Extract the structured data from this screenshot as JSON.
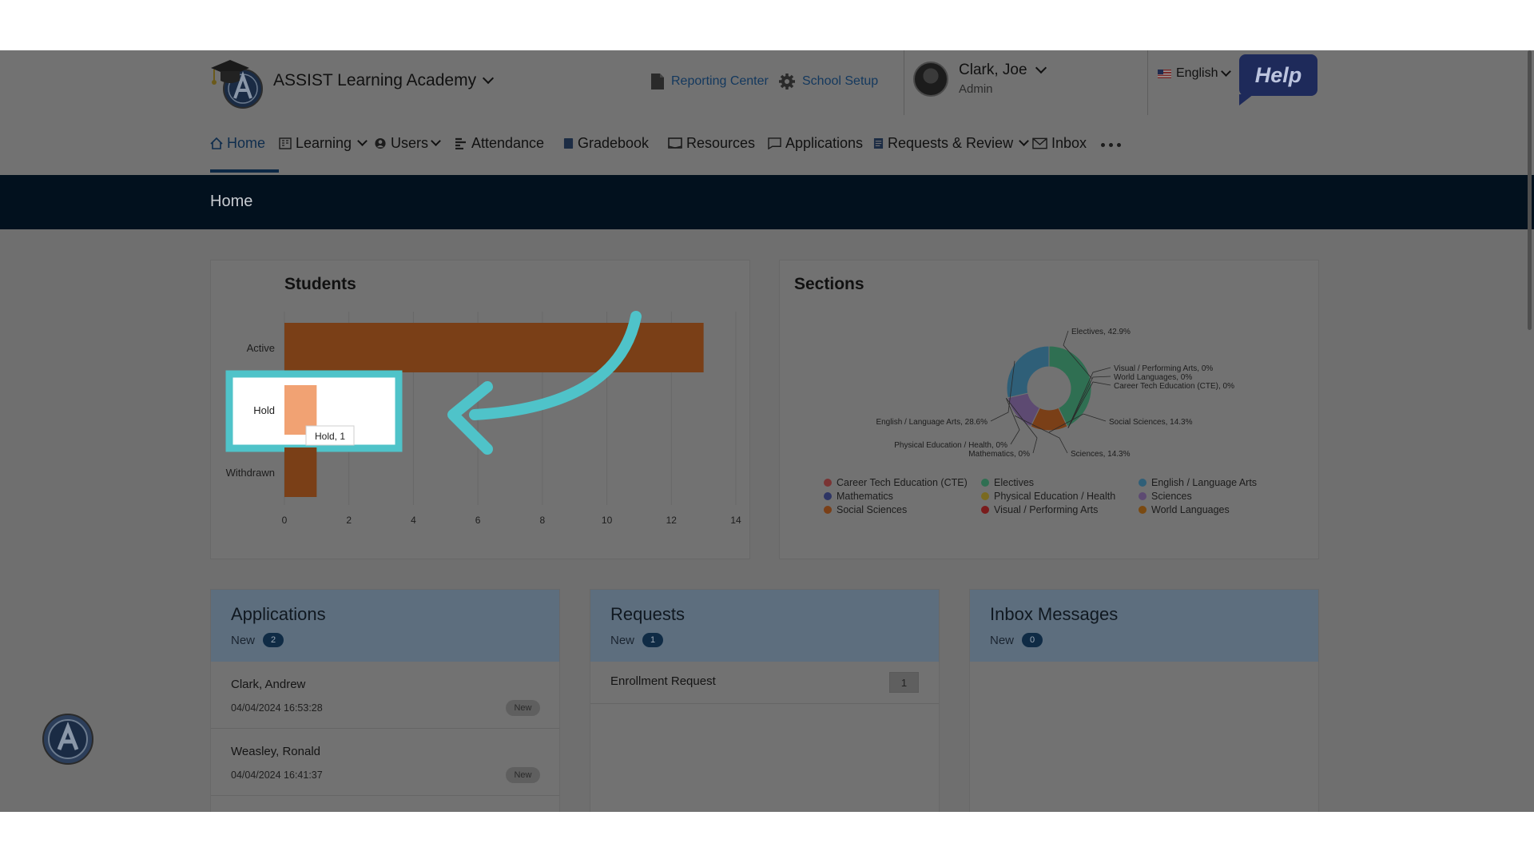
{
  "header": {
    "school_name": "ASSIST Learning Academy",
    "reporting_center": "Reporting Center",
    "school_setup": "School Setup",
    "user_name": "Clark, Joe",
    "user_role": "Admin",
    "language": "English",
    "help_label": "Help"
  },
  "nav": {
    "items": [
      {
        "label": "Home",
        "icon": "home-icon",
        "active": true
      },
      {
        "label": "Learning",
        "icon": "learning-icon",
        "dropdown": true
      },
      {
        "label": "Users",
        "icon": "users-icon",
        "dropdown": true
      },
      {
        "label": "Attendance",
        "icon": "attendance-icon"
      },
      {
        "label": "Gradebook",
        "icon": "gradebook-icon"
      },
      {
        "label": "Resources",
        "icon": "resources-icon"
      },
      {
        "label": "Applications",
        "icon": "applications-icon"
      },
      {
        "label": "Requests & Review",
        "icon": "requests-icon",
        "dropdown": true
      },
      {
        "label": "Inbox",
        "icon": "inbox-icon"
      }
    ]
  },
  "page_title": "Home",
  "students": {
    "title": "Students",
    "tooltip": "Hold, 1"
  },
  "sections": {
    "title": "Sections"
  },
  "chart_data": [
    {
      "type": "bar",
      "orientation": "horizontal",
      "title": "Students",
      "categories": [
        "Active",
        "Hold",
        "Withdrawn"
      ],
      "values": [
        13,
        1,
        1
      ],
      "xlim": [
        0,
        14
      ],
      "xticks": [
        0,
        2,
        4,
        6,
        8,
        10,
        12,
        14
      ],
      "grid": true,
      "highlight": "Hold",
      "colors": {
        "bar": "#7a3f17",
        "highlight_bar": "#f1a273"
      }
    },
    {
      "type": "pie",
      "donut": true,
      "title": "Sections",
      "slices": [
        {
          "name": "Electives",
          "value": 42.9,
          "label": "Electives, 42.9%",
          "color": "#2f6f52"
        },
        {
          "name": "Visual / Performing Arts",
          "value": 0,
          "label": "Visual / Performing Arts, 0%",
          "color": "#7a1c1c"
        },
        {
          "name": "World Languages",
          "value": 0,
          "label": "World Languages, 0%",
          "color": "#7a4a12"
        },
        {
          "name": "Career Tech Education (CTE)",
          "value": 0,
          "label": "Career Tech Education (CTE), 0%",
          "color": "#7a3434"
        },
        {
          "name": "Social Sciences",
          "value": 14.3,
          "label": "Social Sciences, 14.3%",
          "color": "#7a3f17"
        },
        {
          "name": "Sciences",
          "value": 14.3,
          "label": "Sciences, 14.3%",
          "color": "#5d4a72"
        },
        {
          "name": "Mathematics",
          "value": 0,
          "label": "Mathematics, 0%",
          "color": "#2e3564"
        },
        {
          "name": "Physical Education / Health",
          "value": 0,
          "label": "Physical Education / Health, 0%",
          "color": "#7a6a20"
        },
        {
          "name": "English / Language Arts",
          "value": 28.6,
          "label": "English / Language Arts, 28.6%",
          "color": "#2f5f78"
        }
      ],
      "legend": [
        {
          "name": "Career Tech Education (CTE)",
          "color": "#7a3434"
        },
        {
          "name": "Electives",
          "color": "#2f6f52"
        },
        {
          "name": "English / Language Arts",
          "color": "#2f5f78"
        },
        {
          "name": "Mathematics",
          "color": "#2e3564"
        },
        {
          "name": "Physical Education / Health",
          "color": "#7a6a20"
        },
        {
          "name": "Sciences",
          "color": "#5d4a72"
        },
        {
          "name": "Social Sciences",
          "color": "#7a3f17"
        },
        {
          "name": "Visual / Performing Arts",
          "color": "#7a1c1c"
        },
        {
          "name": "World Languages",
          "color": "#7a4a12"
        }
      ],
      "legend_placement": "bottom"
    }
  ],
  "applications": {
    "title": "Applications",
    "new_label": "New",
    "new_count": "2",
    "items": [
      {
        "name": "Clark, Andrew",
        "date": "04/04/2024 16:53:28",
        "badge": "New"
      },
      {
        "name": "Weasley, Ronald",
        "date": "04/04/2024 16:41:37",
        "badge": "New"
      }
    ]
  },
  "requests": {
    "title": "Requests",
    "new_label": "New",
    "new_count": "1",
    "items": [
      {
        "name": "Enrollment Request",
        "count": "1"
      }
    ]
  },
  "inbox": {
    "title": "Inbox Messages",
    "new_label": "New",
    "new_count": "0"
  },
  "colors": {
    "highlight_box": "#4fc3c9",
    "arrow": "#4fc3c9",
    "title_band": "#02111e",
    "help_badge": "#1e2a5a"
  }
}
